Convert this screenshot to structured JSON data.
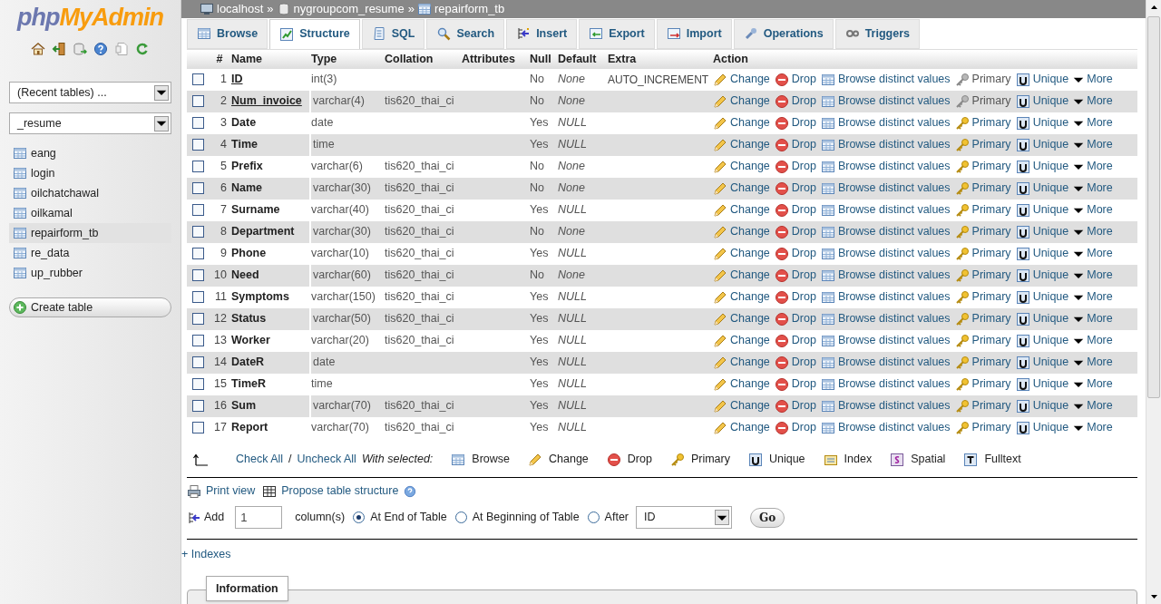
{
  "sidebar": {
    "logo": {
      "php": "php",
      "rest": "MyAdmin"
    },
    "recent_tables": "(Recent tables) ...",
    "database": "_resume",
    "tables": [
      {
        "name": "eang",
        "selected": false
      },
      {
        "name": "login",
        "selected": false
      },
      {
        "name": "oilchatchawal",
        "selected": false
      },
      {
        "name": "oilkamal",
        "selected": false
      },
      {
        "name": "repairform_tb",
        "selected": true
      },
      {
        "name": "re_data",
        "selected": false
      },
      {
        "name": "up_rubber",
        "selected": false
      }
    ],
    "create_table": "Create table"
  },
  "breadcrumb": [
    "localhost",
    "nygroupcom_resume",
    "repairform_tb"
  ],
  "breadcrumb_separator": "»",
  "tabs": [
    {
      "label": "Browse",
      "selected": false
    },
    {
      "label": "Structure",
      "selected": true
    },
    {
      "label": "SQL",
      "selected": false
    },
    {
      "label": "Search",
      "selected": false
    },
    {
      "label": "Insert",
      "selected": false
    },
    {
      "label": "Export",
      "selected": false
    },
    {
      "label": "Import",
      "selected": false
    },
    {
      "label": "Operations",
      "selected": false
    },
    {
      "label": "Triggers",
      "selected": false
    }
  ],
  "table": {
    "columns": [
      "#",
      "Name",
      "Type",
      "Collation",
      "Attributes",
      "Null",
      "Default",
      "Extra",
      "Action"
    ],
    "rows": [
      {
        "num": "1",
        "name": "ID",
        "type": "int(3)",
        "collation": "",
        "null": "No",
        "default": "None",
        "extra": "AUTO_INCREMENT",
        "primary_key": true,
        "checked": false,
        "actions": [
          "Change",
          "Drop",
          "Browse distinct values",
          "Primary",
          "Unique",
          "More"
        ]
      },
      {
        "num": "2",
        "name": "Num_invoice",
        "type": "varchar(4)",
        "collation": "tis620_thai_ci",
        "null": "No",
        "default": "None",
        "extra": "",
        "primary_key": true,
        "checked": false,
        "actions": [
          "Change",
          "Drop",
          "Browse distinct values",
          "Primary",
          "Unique",
          "More"
        ]
      },
      {
        "num": "3",
        "name": "Date",
        "type": "date",
        "collation": "",
        "null": "Yes",
        "default": "NULL",
        "extra": "",
        "primary_key": false,
        "checked": false,
        "actions": [
          "Change",
          "Drop",
          "Browse distinct values",
          "Primary",
          "Unique",
          "More"
        ]
      },
      {
        "num": "4",
        "name": "Time",
        "type": "time",
        "collation": "",
        "null": "Yes",
        "default": "NULL",
        "extra": "",
        "primary_key": false,
        "checked": false,
        "actions": [
          "Change",
          "Drop",
          "Browse distinct values",
          "Primary",
          "Unique",
          "More"
        ]
      },
      {
        "num": "5",
        "name": "Prefix",
        "type": "varchar(6)",
        "collation": "tis620_thai_ci",
        "null": "No",
        "default": "None",
        "extra": "",
        "primary_key": false,
        "checked": false,
        "actions": [
          "Change",
          "Drop",
          "Browse distinct values",
          "Primary",
          "Unique",
          "More"
        ]
      },
      {
        "num": "6",
        "name": "Name",
        "type": "varchar(30)",
        "collation": "tis620_thai_ci",
        "null": "No",
        "default": "None",
        "extra": "",
        "primary_key": false,
        "checked": false,
        "actions": [
          "Change",
          "Drop",
          "Browse distinct values",
          "Primary",
          "Unique",
          "More"
        ]
      },
      {
        "num": "7",
        "name": "Surname",
        "type": "varchar(40)",
        "collation": "tis620_thai_ci",
        "null": "Yes",
        "default": "NULL",
        "extra": "",
        "primary_key": false,
        "checked": false,
        "actions": [
          "Change",
          "Drop",
          "Browse distinct values",
          "Primary",
          "Unique",
          "More"
        ]
      },
      {
        "num": "8",
        "name": "Department",
        "type": "varchar(30)",
        "collation": "tis620_thai_ci",
        "null": "No",
        "default": "None",
        "extra": "",
        "primary_key": false,
        "checked": false,
        "actions": [
          "Change",
          "Drop",
          "Browse distinct values",
          "Primary",
          "Unique",
          "More"
        ]
      },
      {
        "num": "9",
        "name": "Phone",
        "type": "varchar(10)",
        "collation": "tis620_thai_ci",
        "null": "Yes",
        "default": "NULL",
        "extra": "",
        "primary_key": false,
        "checked": false,
        "actions": [
          "Change",
          "Drop",
          "Browse distinct values",
          "Primary",
          "Unique",
          "More"
        ]
      },
      {
        "num": "10",
        "name": "Need",
        "type": "varchar(60)",
        "collation": "tis620_thai_ci",
        "null": "No",
        "default": "None",
        "extra": "",
        "primary_key": false,
        "checked": false,
        "actions": [
          "Change",
          "Drop",
          "Browse distinct values",
          "Primary",
          "Unique",
          "More"
        ]
      },
      {
        "num": "11",
        "name": "Symptoms",
        "type": "varchar(150)",
        "collation": "tis620_thai_ci",
        "null": "Yes",
        "default": "NULL",
        "extra": "",
        "primary_key": false,
        "checked": false,
        "actions": [
          "Change",
          "Drop",
          "Browse distinct values",
          "Primary",
          "Unique",
          "More"
        ]
      },
      {
        "num": "12",
        "name": "Status",
        "type": "varchar(50)",
        "collation": "tis620_thai_ci",
        "null": "Yes",
        "default": "NULL",
        "extra": "",
        "primary_key": false,
        "checked": false,
        "actions": [
          "Change",
          "Drop",
          "Browse distinct values",
          "Primary",
          "Unique",
          "More"
        ]
      },
      {
        "num": "13",
        "name": "Worker",
        "type": "varchar(20)",
        "collation": "tis620_thai_ci",
        "null": "Yes",
        "default": "NULL",
        "extra": "",
        "primary_key": false,
        "checked": false,
        "actions": [
          "Change",
          "Drop",
          "Browse distinct values",
          "Primary",
          "Unique",
          "More"
        ]
      },
      {
        "num": "14",
        "name": "DateR",
        "type": "date",
        "collation": "",
        "null": "Yes",
        "default": "NULL",
        "extra": "",
        "primary_key": false,
        "checked": false,
        "actions": [
          "Change",
          "Drop",
          "Browse distinct values",
          "Primary",
          "Unique",
          "More"
        ]
      },
      {
        "num": "15",
        "name": "TimeR",
        "type": "time",
        "collation": "",
        "null": "Yes",
        "default": "NULL",
        "extra": "",
        "primary_key": false,
        "checked": false,
        "actions": [
          "Change",
          "Drop",
          "Browse distinct values",
          "Primary",
          "Unique",
          "More"
        ]
      },
      {
        "num": "16",
        "name": "Sum",
        "type": "varchar(70)",
        "collation": "tis620_thai_ci",
        "null": "Yes",
        "default": "NULL",
        "extra": "",
        "primary_key": false,
        "checked": false,
        "actions": [
          "Change",
          "Drop",
          "Browse distinct values",
          "Primary",
          "Unique",
          "More"
        ]
      },
      {
        "num": "17",
        "name": "Report",
        "type": "varchar(70)",
        "collation": "tis620_thai_ci",
        "null": "Yes",
        "default": "NULL",
        "extra": "",
        "primary_key": false,
        "checked": false,
        "actions": [
          "Change",
          "Drop",
          "Browse distinct values",
          "Primary",
          "Unique",
          "More"
        ]
      }
    ]
  },
  "bulk": {
    "check_all": "Check All",
    "slash": "/",
    "uncheck_all": "Uncheck All",
    "with_selected": "With selected:",
    "actions": [
      "Browse",
      "Change",
      "Drop",
      "Primary",
      "Unique",
      "Index",
      "Spatial",
      "Fulltext"
    ]
  },
  "print_view": "Print view",
  "propose": "Propose table structure",
  "add_column": {
    "add": "Add",
    "count": "1",
    "columns_label": "column(s)",
    "positions": [
      {
        "label": "At End of Table",
        "selected": true
      },
      {
        "label": "At Beginning of Table",
        "selected": false
      },
      {
        "label": "After",
        "selected": false
      }
    ],
    "after_field": "ID",
    "go": "Go"
  },
  "indexes": "+ Indexes",
  "information": "Information"
}
